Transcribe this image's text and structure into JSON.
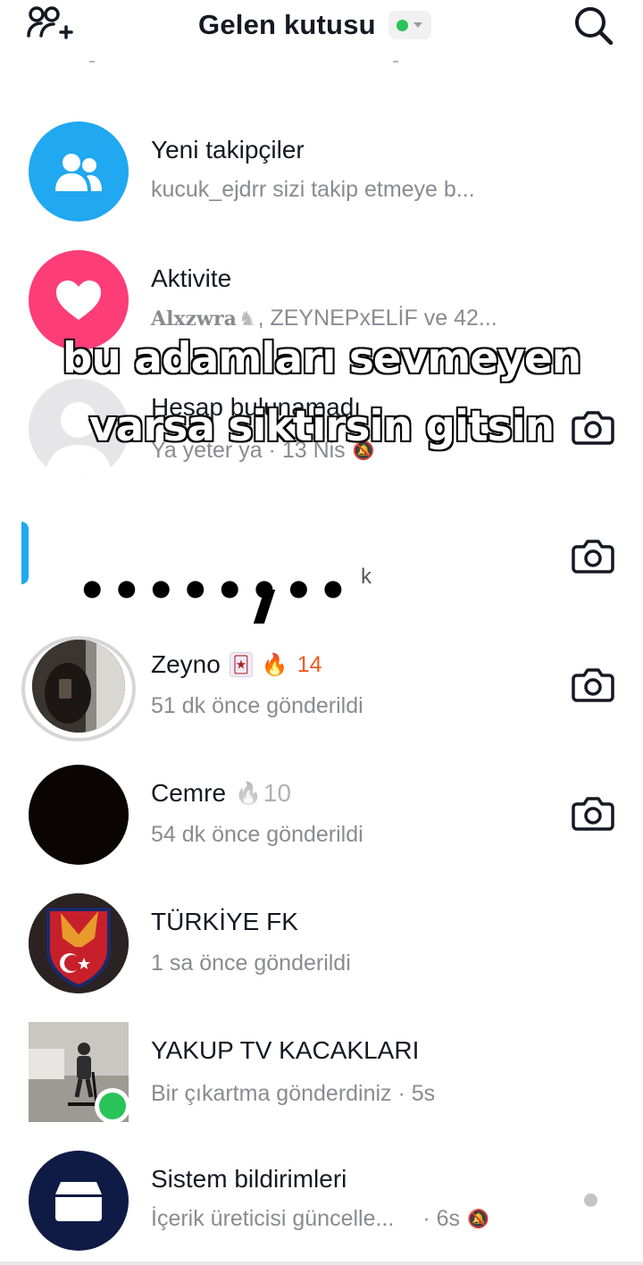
{
  "header": {
    "title": "Gelen kutusu",
    "status_color": "#2ac35a",
    "add_friends_icon": "add-friends-icon",
    "search_icon": "search-icon"
  },
  "overlay": {
    "line1": "bu adamları sevmeyen",
    "line2": "varsa siktirsin gitsin",
    "dots": "••••••••",
    "k": "k"
  },
  "rows": {
    "followers": {
      "title": "Yeni takipçiler",
      "subtitle": "kucuk_ejdrr sizi takip etmeye b..."
    },
    "activity": {
      "title": "Aktivite",
      "user1": "Alxzwra",
      "subtitle_rest": ", ZEYNEPxELİF ve 42..."
    },
    "hidden_account": {
      "title": "Hesap bulunamadı",
      "subtitle": "Ya yeter ya · 13 Nis"
    },
    "zeyno": {
      "title": "Zeyno",
      "streak": "14",
      "subtitle": "51 dk önce gönderildi"
    },
    "cemre": {
      "title": "Cemre",
      "streak": "10",
      "subtitle": "54 dk önce gönderildi"
    },
    "turkiye": {
      "title": "TÜRKİYE FK",
      "subtitle": "1 sa önce gönderildi"
    },
    "yakup": {
      "title": "YAKUP TV KACAKLARI",
      "subtitle": "Bir çıkartma gönderdiniz · 5s"
    },
    "system": {
      "title": "Sistem bildirimleri",
      "subtitle": "İçerik üreticisi güncelle...",
      "time": "· 6s"
    }
  }
}
